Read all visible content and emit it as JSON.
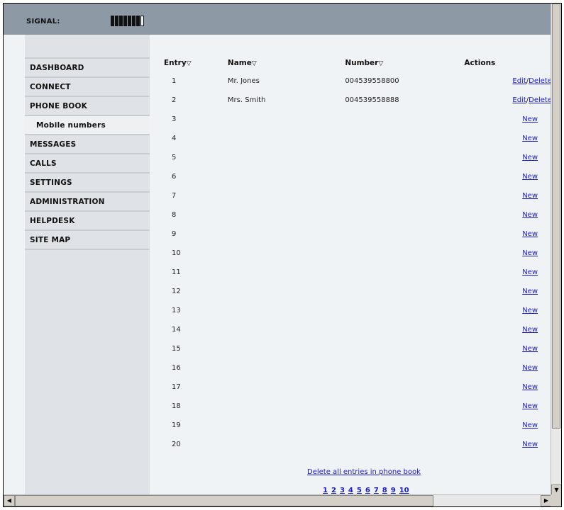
{
  "header": {
    "signal_label": "SIGNAL:",
    "signal_level": "7/8"
  },
  "sidebar": {
    "items": [
      {
        "label": "DASHBOARD"
      },
      {
        "label": "CONNECT"
      },
      {
        "label": "PHONE BOOK"
      },
      {
        "label": "Mobile numbers"
      },
      {
        "label": "MESSAGES"
      },
      {
        "label": "CALLS"
      },
      {
        "label": "SETTINGS"
      },
      {
        "label": "ADMINISTRATION"
      },
      {
        "label": "HELPDESK"
      },
      {
        "label": "SITE MAP"
      }
    ]
  },
  "table": {
    "headers": {
      "entry": "Entry",
      "name": "Name",
      "number": "Number",
      "actions": "Actions",
      "sort_glyph": "▽"
    },
    "rows": [
      {
        "entry": "1",
        "name": "Mr. Jones",
        "number": "004539558800",
        "edit": "Edit",
        "sep": "/",
        "delete": "Delete"
      },
      {
        "entry": "2",
        "name": "Mrs. Smith",
        "number": "004539558888",
        "edit": "Edit",
        "sep": "/",
        "delete": "Delete"
      },
      {
        "entry": "3",
        "new": "New"
      },
      {
        "entry": "4",
        "new": "New"
      },
      {
        "entry": "5",
        "new": "New"
      },
      {
        "entry": "6",
        "new": "New"
      },
      {
        "entry": "7",
        "new": "New"
      },
      {
        "entry": "8",
        "new": "New"
      },
      {
        "entry": "9",
        "new": "New"
      },
      {
        "entry": "10",
        "new": "New"
      },
      {
        "entry": "11",
        "new": "New"
      },
      {
        "entry": "12",
        "new": "New"
      },
      {
        "entry": "13",
        "new": "New"
      },
      {
        "entry": "14",
        "new": "New"
      },
      {
        "entry": "15",
        "new": "New"
      },
      {
        "entry": "16",
        "new": "New"
      },
      {
        "entry": "17",
        "new": "New"
      },
      {
        "entry": "18",
        "new": "New"
      },
      {
        "entry": "19",
        "new": "New"
      },
      {
        "entry": "20",
        "new": "New"
      }
    ]
  },
  "footer": {
    "delete_all": "Delete all entries in phone book",
    "pages": [
      "1",
      "2",
      "3",
      "4",
      "5",
      "6",
      "7",
      "8",
      "9",
      "10"
    ]
  },
  "colors": {
    "topbar": "#8d9aa6",
    "sidebar": "#dfe3e7",
    "content": "#f0f3f6",
    "link": "#1a1acc"
  }
}
